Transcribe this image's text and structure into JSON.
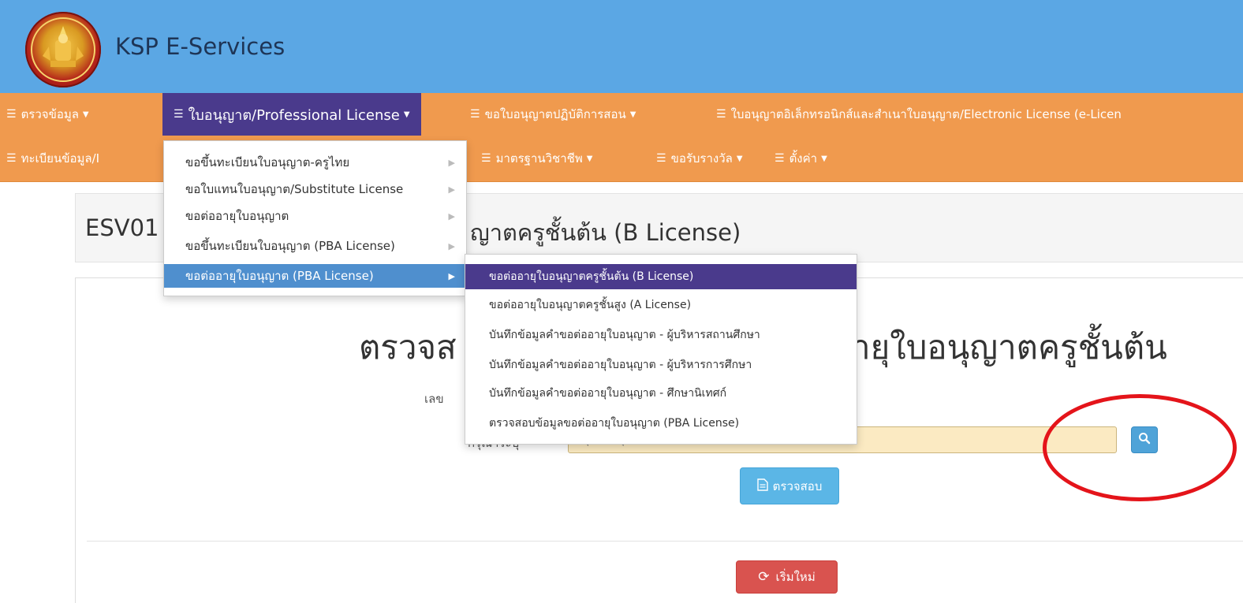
{
  "header": {
    "brand": "KSP E-Services"
  },
  "nav": {
    "row1": [
      {
        "label": "ตรวจข้อมูล",
        "has_caret": true
      },
      {
        "label": "ใบอนุญาต/Professional License",
        "has_caret": true,
        "active": true
      },
      {
        "label": "ขอใบอนุญาตปฏิบัติการสอน",
        "has_caret": true
      },
      {
        "label": "ใบอนุญาตอิเล็กทรอนิกส์และสำเนาใบอนุญาต/Electronic License (e-Licen",
        "has_caret": false
      }
    ],
    "row2": [
      {
        "label": "ทะเบียนข้อมูล/I",
        "has_caret": false
      },
      {
        "label": "มาตรฐานวิชาชีพ",
        "has_caret": true
      },
      {
        "label": "ขอรับรางวัล",
        "has_caret": true
      },
      {
        "label": "ตั้งค่า",
        "has_caret": true
      }
    ]
  },
  "dropdown_license": {
    "items": [
      {
        "label": "ขอขึ้นทะเบียนใบอนุญาต-ครูไทย"
      },
      {
        "label": "ขอใบแทนใบอนุญาต/Substitute License"
      },
      {
        "label": "ขอต่ออายุใบอนุญาต"
      },
      {
        "label": "ขอขึ้นทะเบียนใบอนุญาต (PBA License)"
      },
      {
        "label": "ขอต่ออายุใบอนุญาต (PBA License)",
        "active": true
      }
    ]
  },
  "dropdown_pba": {
    "items": [
      {
        "label": "ขอต่ออายุใบอนุญาตครูชั้นต้น (B License)",
        "active": true
      },
      {
        "label": "ขอต่ออายุใบอนุญาตครูชั้นสูง (A License)"
      },
      {
        "label": "บันทึกข้อมูลคำขอต่ออายุใบอนุญาต - ผู้บริหารสถานศึกษา"
      },
      {
        "label": "บันทึกข้อมูลคำขอต่ออายุใบอนุญาต - ผู้บริหารการศึกษา"
      },
      {
        "label": "บันทึกข้อมูลคำขอต่ออายุใบอนุญาต - ศึกษานิเทศก์"
      },
      {
        "label": "ตรวจสอบข้อมูลขอต่ออายุใบอนุญาต (PBA License)"
      }
    ]
  },
  "page": {
    "title_left": "ESV01",
    "title_right": "ญาตครูชั้นต้น (B License)",
    "heading_left": "ตรวจส",
    "heading_right": "ายุใบอนุญาตครูชั้นต้น",
    "label_1": "เลข",
    "label_2": "กรุณาระบุ",
    "input_placeholder": "กรุณาระบุ",
    "check_button": "ตรวจสอบ",
    "reset_button": "เริ่มใหม่"
  },
  "colors": {
    "header_bg": "#5ba7e4",
    "navbar_bg": "#f09a4e",
    "active_nav": "#4a3a8c",
    "annotation": "#e4141a"
  }
}
